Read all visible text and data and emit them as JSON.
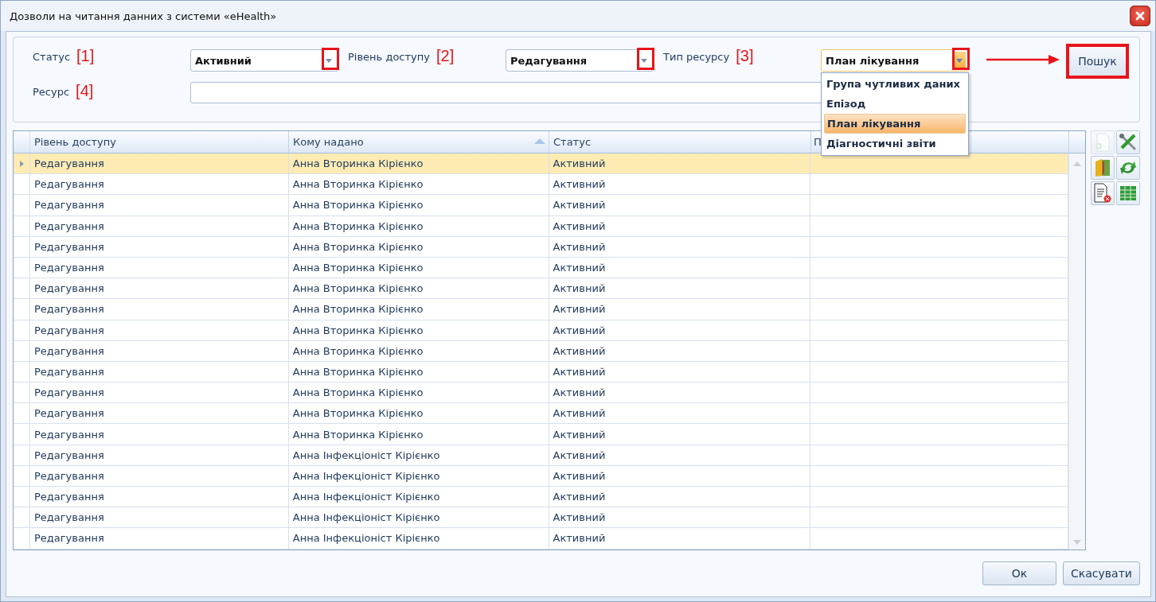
{
  "window": {
    "title": "Дозволи на читання данних з системи «eHealth»"
  },
  "filters": [
    {
      "label": "Статус",
      "marker": "[1]",
      "value": "Активний",
      "expanded": false
    },
    {
      "label": "Рівень доступу",
      "marker": "[2]",
      "value": "Редагування",
      "expanded": false
    },
    {
      "label": "Тип ресурсу",
      "marker": "[3]",
      "value": "План лікування",
      "expanded": true
    }
  ],
  "resource": {
    "label": "Ресурс",
    "marker": "[4]"
  },
  "search_button": "Пошук",
  "dropdown": [
    {
      "label": "Група чутливих даних",
      "selected": false
    },
    {
      "label": "Епізод",
      "selected": false
    },
    {
      "label": "План лікування",
      "selected": true
    },
    {
      "label": "Діагностичні звіти",
      "selected": false
    }
  ],
  "table": {
    "columns": [
      {
        "label": "Рівень доступу",
        "sorted": false
      },
      {
        "label": "Кому надано",
        "sorted": true
      },
      {
        "label": "Статус",
        "sorted": false
      },
      {
        "label": "П",
        "sorted": false
      }
    ],
    "rows": [
      {
        "access": "Редагування",
        "granted_to": "Анна Вторинка Кірієнко",
        "status": "Активний",
        "selected": true
      },
      {
        "access": "Редагування",
        "granted_to": "Анна Вторинка Кірієнко",
        "status": "Активний",
        "selected": false
      },
      {
        "access": "Редагування",
        "granted_to": "Анна Вторинка Кірієнко",
        "status": "Активний",
        "selected": false
      },
      {
        "access": "Редагування",
        "granted_to": "Анна Вторинка Кірієнко",
        "status": "Активний",
        "selected": false
      },
      {
        "access": "Редагування",
        "granted_to": "Анна Вторинка Кірієнко",
        "status": "Активний",
        "selected": false
      },
      {
        "access": "Редагування",
        "granted_to": "Анна Вторинка Кірієнко",
        "status": "Активний",
        "selected": false
      },
      {
        "access": "Редагування",
        "granted_to": "Анна Вторинка Кірієнко",
        "status": "Активний",
        "selected": false
      },
      {
        "access": "Редагування",
        "granted_to": "Анна Вторинка Кірієнко",
        "status": "Активний",
        "selected": false
      },
      {
        "access": "Редагування",
        "granted_to": "Анна Вторинка Кірієнко",
        "status": "Активний",
        "selected": false
      },
      {
        "access": "Редагування",
        "granted_to": "Анна Вторинка Кірієнко",
        "status": "Активний",
        "selected": false
      },
      {
        "access": "Редагування",
        "granted_to": "Анна Вторинка Кірієнко",
        "status": "Активний",
        "selected": false
      },
      {
        "access": "Редагування",
        "granted_to": "Анна Вторинка Кірієнко",
        "status": "Активний",
        "selected": false
      },
      {
        "access": "Редагування",
        "granted_to": "Анна Вторинка Кірієнко",
        "status": "Активний",
        "selected": false
      },
      {
        "access": "Редагування",
        "granted_to": "Анна Вторинка Кірієнко",
        "status": "Активний",
        "selected": false
      },
      {
        "access": "Редагування",
        "granted_to": "Анна Інфекціоніст Кірієнко",
        "status": "Активний",
        "selected": false
      },
      {
        "access": "Редагування",
        "granted_to": "Анна Інфекціоніст Кірієнко",
        "status": "Активний",
        "selected": false
      },
      {
        "access": "Редагування",
        "granted_to": "Анна Інфекціоніст Кірієнко",
        "status": "Активний",
        "selected": false
      },
      {
        "access": "Редагування",
        "granted_to": "Анна Інфекціоніст Кірієнко",
        "status": "Активний",
        "selected": false
      },
      {
        "access": "Редагування",
        "granted_to": "Анна Інфекціоніст Кірієнко",
        "status": "Активний",
        "selected": false
      }
    ]
  },
  "toolbar": [
    {
      "kind": "add",
      "disabled": true
    },
    {
      "kind": "tools",
      "disabled": false
    },
    {
      "kind": "book",
      "disabled": false
    },
    {
      "kind": "refresh",
      "disabled": false
    },
    {
      "kind": "remove",
      "disabled": false
    },
    {
      "kind": "grid",
      "disabled": false
    }
  ],
  "buttons": [
    "Ок",
    "Скасувати"
  ]
}
